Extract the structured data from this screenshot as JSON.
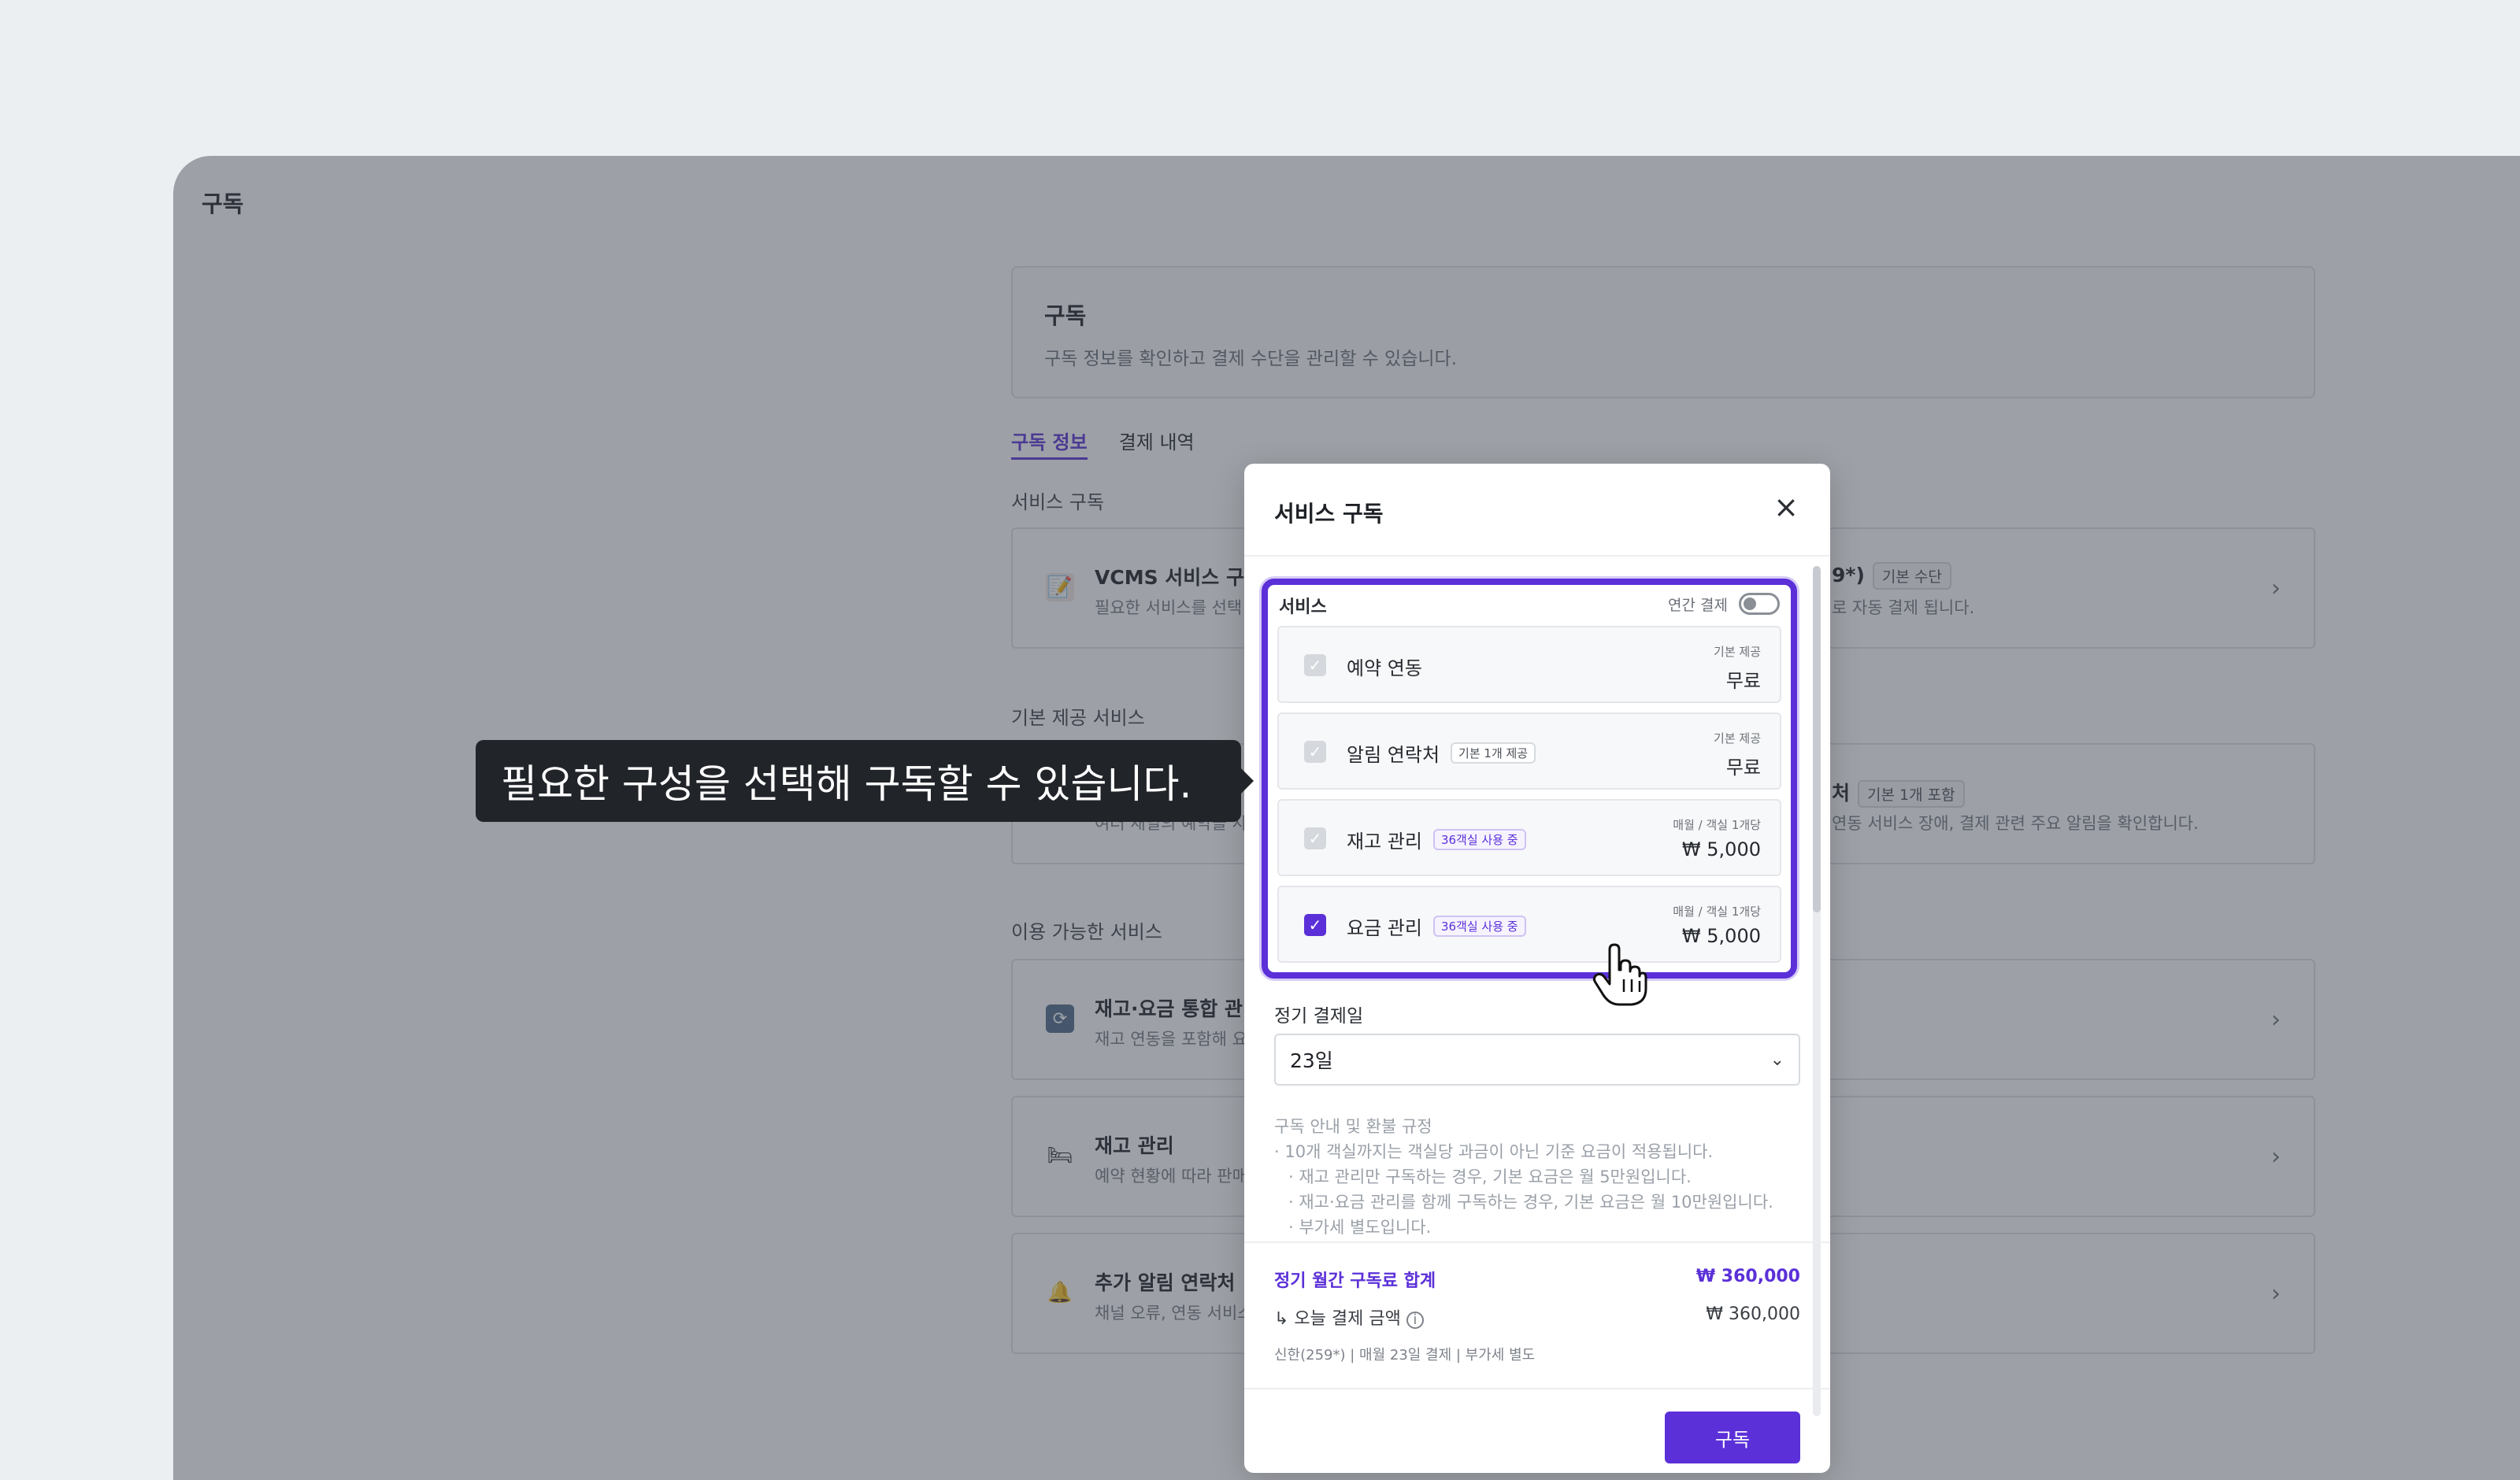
{
  "app": {
    "title": "구독"
  },
  "header": {
    "title": "구독",
    "description": "구독 정보를 확인하고 결제 수단을 관리할 수 있습니다."
  },
  "tabs": [
    {
      "label": "구독 정보",
      "active": true
    },
    {
      "label": "결제 내역",
      "active": false
    }
  ],
  "sections": {
    "subscription": "서비스 구독",
    "basic": "기본 제공 서비스",
    "available": "이용 가능한 서비스"
  },
  "cards": {
    "vcms": {
      "title": "VCMS 서비스 구독",
      "subtitle": "필요한 서비스를 선택",
      "right_title": "9*)",
      "right_badge": "기본 수단",
      "right_sub": "로 자동 결제 됩니다."
    },
    "basic": {
      "subtitle": "여러 채널의 예약을 사",
      "right_title": "처",
      "right_badge": "기본 1개 포함",
      "right_sub": "연동 서비스 장애, 결제 관련 주요 알림을 확인합니다."
    },
    "integrated": {
      "title": "재고·요금 통합 관리",
      "subtitle": "재고 연동을 포함해 요"
    },
    "inventory": {
      "title": "재고 관리",
      "subtitle": "예약 현황에 따라 판매"
    },
    "contacts": {
      "title": "추가 알림 연락처",
      "subtitle": "채널 오류, 연동 서비스"
    }
  },
  "modal": {
    "title": "서비스 구독",
    "services_label": "서비스",
    "annual_label": "연간 결제",
    "services": [
      {
        "name": "예약 연동",
        "tag": "",
        "meta": "기본 제공",
        "price": "무료",
        "checked": false
      },
      {
        "name": "알림 연락처",
        "tag": "기본 1개 제공",
        "meta": "기본 제공",
        "price": "무료",
        "checked": false
      },
      {
        "name": "재고 관리",
        "tag": "36객실 사용 중",
        "meta": "매월 / 객실 1개당",
        "price": "₩ 5,000",
        "checked": false
      },
      {
        "name": "요금 관리",
        "tag": "36객실 사용 중",
        "meta": "매월 / 객실 1개당",
        "price": "₩ 5,000",
        "checked": true
      }
    ],
    "billing_day_label": "정기 결제일",
    "billing_day_value": "23일",
    "notice": {
      "title": "구독 안내 및 환불 규정",
      "line1": "· 10개 객실까지는 객실당 과금이 아닌 기준 요금이 적용됩니다.",
      "line2": "· 재고 관리만 구독하는 경우, 기본 요금은 월 5만원입니다.",
      "line3": "· 재고·요금 관리를 함께 구독하는 경우, 기본 요금은 월 10만원입니다.",
      "line4": "· 부가세 별도입니다."
    },
    "summary": {
      "total_label": "정기 월간 구독료 합계",
      "total_value": "₩ 360,000",
      "today_label": "↳ 오늘 결제 금액",
      "today_value": "₩ 360,000",
      "footnote": "신한(259*) | 매월 23일 결제 | 부가세 별도"
    },
    "submit_label": "구독"
  },
  "tooltip": {
    "text": "필요한 구성을 선택해 구독할 수 있습니다."
  },
  "colors": {
    "accent": "#5b30d8",
    "tooltip_bg": "#212429"
  }
}
